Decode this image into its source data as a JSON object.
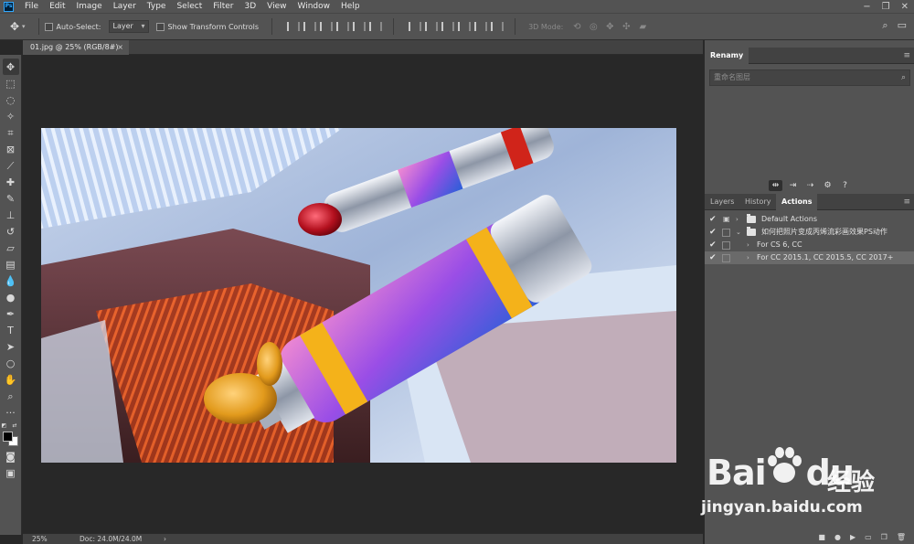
{
  "app": {
    "logo_text": "Ps"
  },
  "menu": [
    "File",
    "Edit",
    "Image",
    "Layer",
    "Type",
    "Select",
    "Filter",
    "3D",
    "View",
    "Window",
    "Help"
  ],
  "window_controls": {
    "minimize": "−",
    "restore": "❐",
    "close": "✕"
  },
  "options_bar": {
    "auto_select_label": "Auto-Select:",
    "auto_select_value": "Layer",
    "show_transform_label": "Show Transform Controls",
    "mode_3d_label": "3D Mode:",
    "icons": {
      "move": "✥",
      "search": "⌕",
      "workspace": "▭"
    }
  },
  "document": {
    "tab_title": "01.jpg @ 25% (RGB/8#)",
    "tab_close": "×"
  },
  "status": {
    "zoom": "25%",
    "doc_info": "Doc: 24.0M/24.0M",
    "arrow": "›"
  },
  "renamy_panel": {
    "title": "Renamy",
    "input_placeholder": "重命名图层",
    "search_icon": "⌕",
    "icons": [
      "⇹",
      "⇥",
      "⇢",
      "⚙",
      "?"
    ]
  },
  "actions_panel": {
    "tabs": [
      "Layers",
      "History",
      "Actions"
    ],
    "active_tab": "Actions",
    "menu_icon": "≡",
    "rows": [
      {
        "text": "Default Actions",
        "selected": false
      },
      {
        "text": "如何把照片变成丙烯流彩画效果PS动作",
        "selected": false
      },
      {
        "text": "For CS 6, CC",
        "selected": false
      },
      {
        "text": "For CC 2015.1, CC 2015.5, CC 2017+",
        "selected": true
      }
    ],
    "checkmark": "✔",
    "footer_icons": [
      "■",
      "●",
      "▶",
      "▭",
      "❐",
      "🗑"
    ]
  },
  "watermark": {
    "brand": "Bai",
    "brand_suffix": "du",
    "cn_text": "经验",
    "url": "jingyan.baidu.com"
  },
  "colors": {
    "foreground": "#000000",
    "background": "#ffffff",
    "accent": "#31a8ff"
  }
}
